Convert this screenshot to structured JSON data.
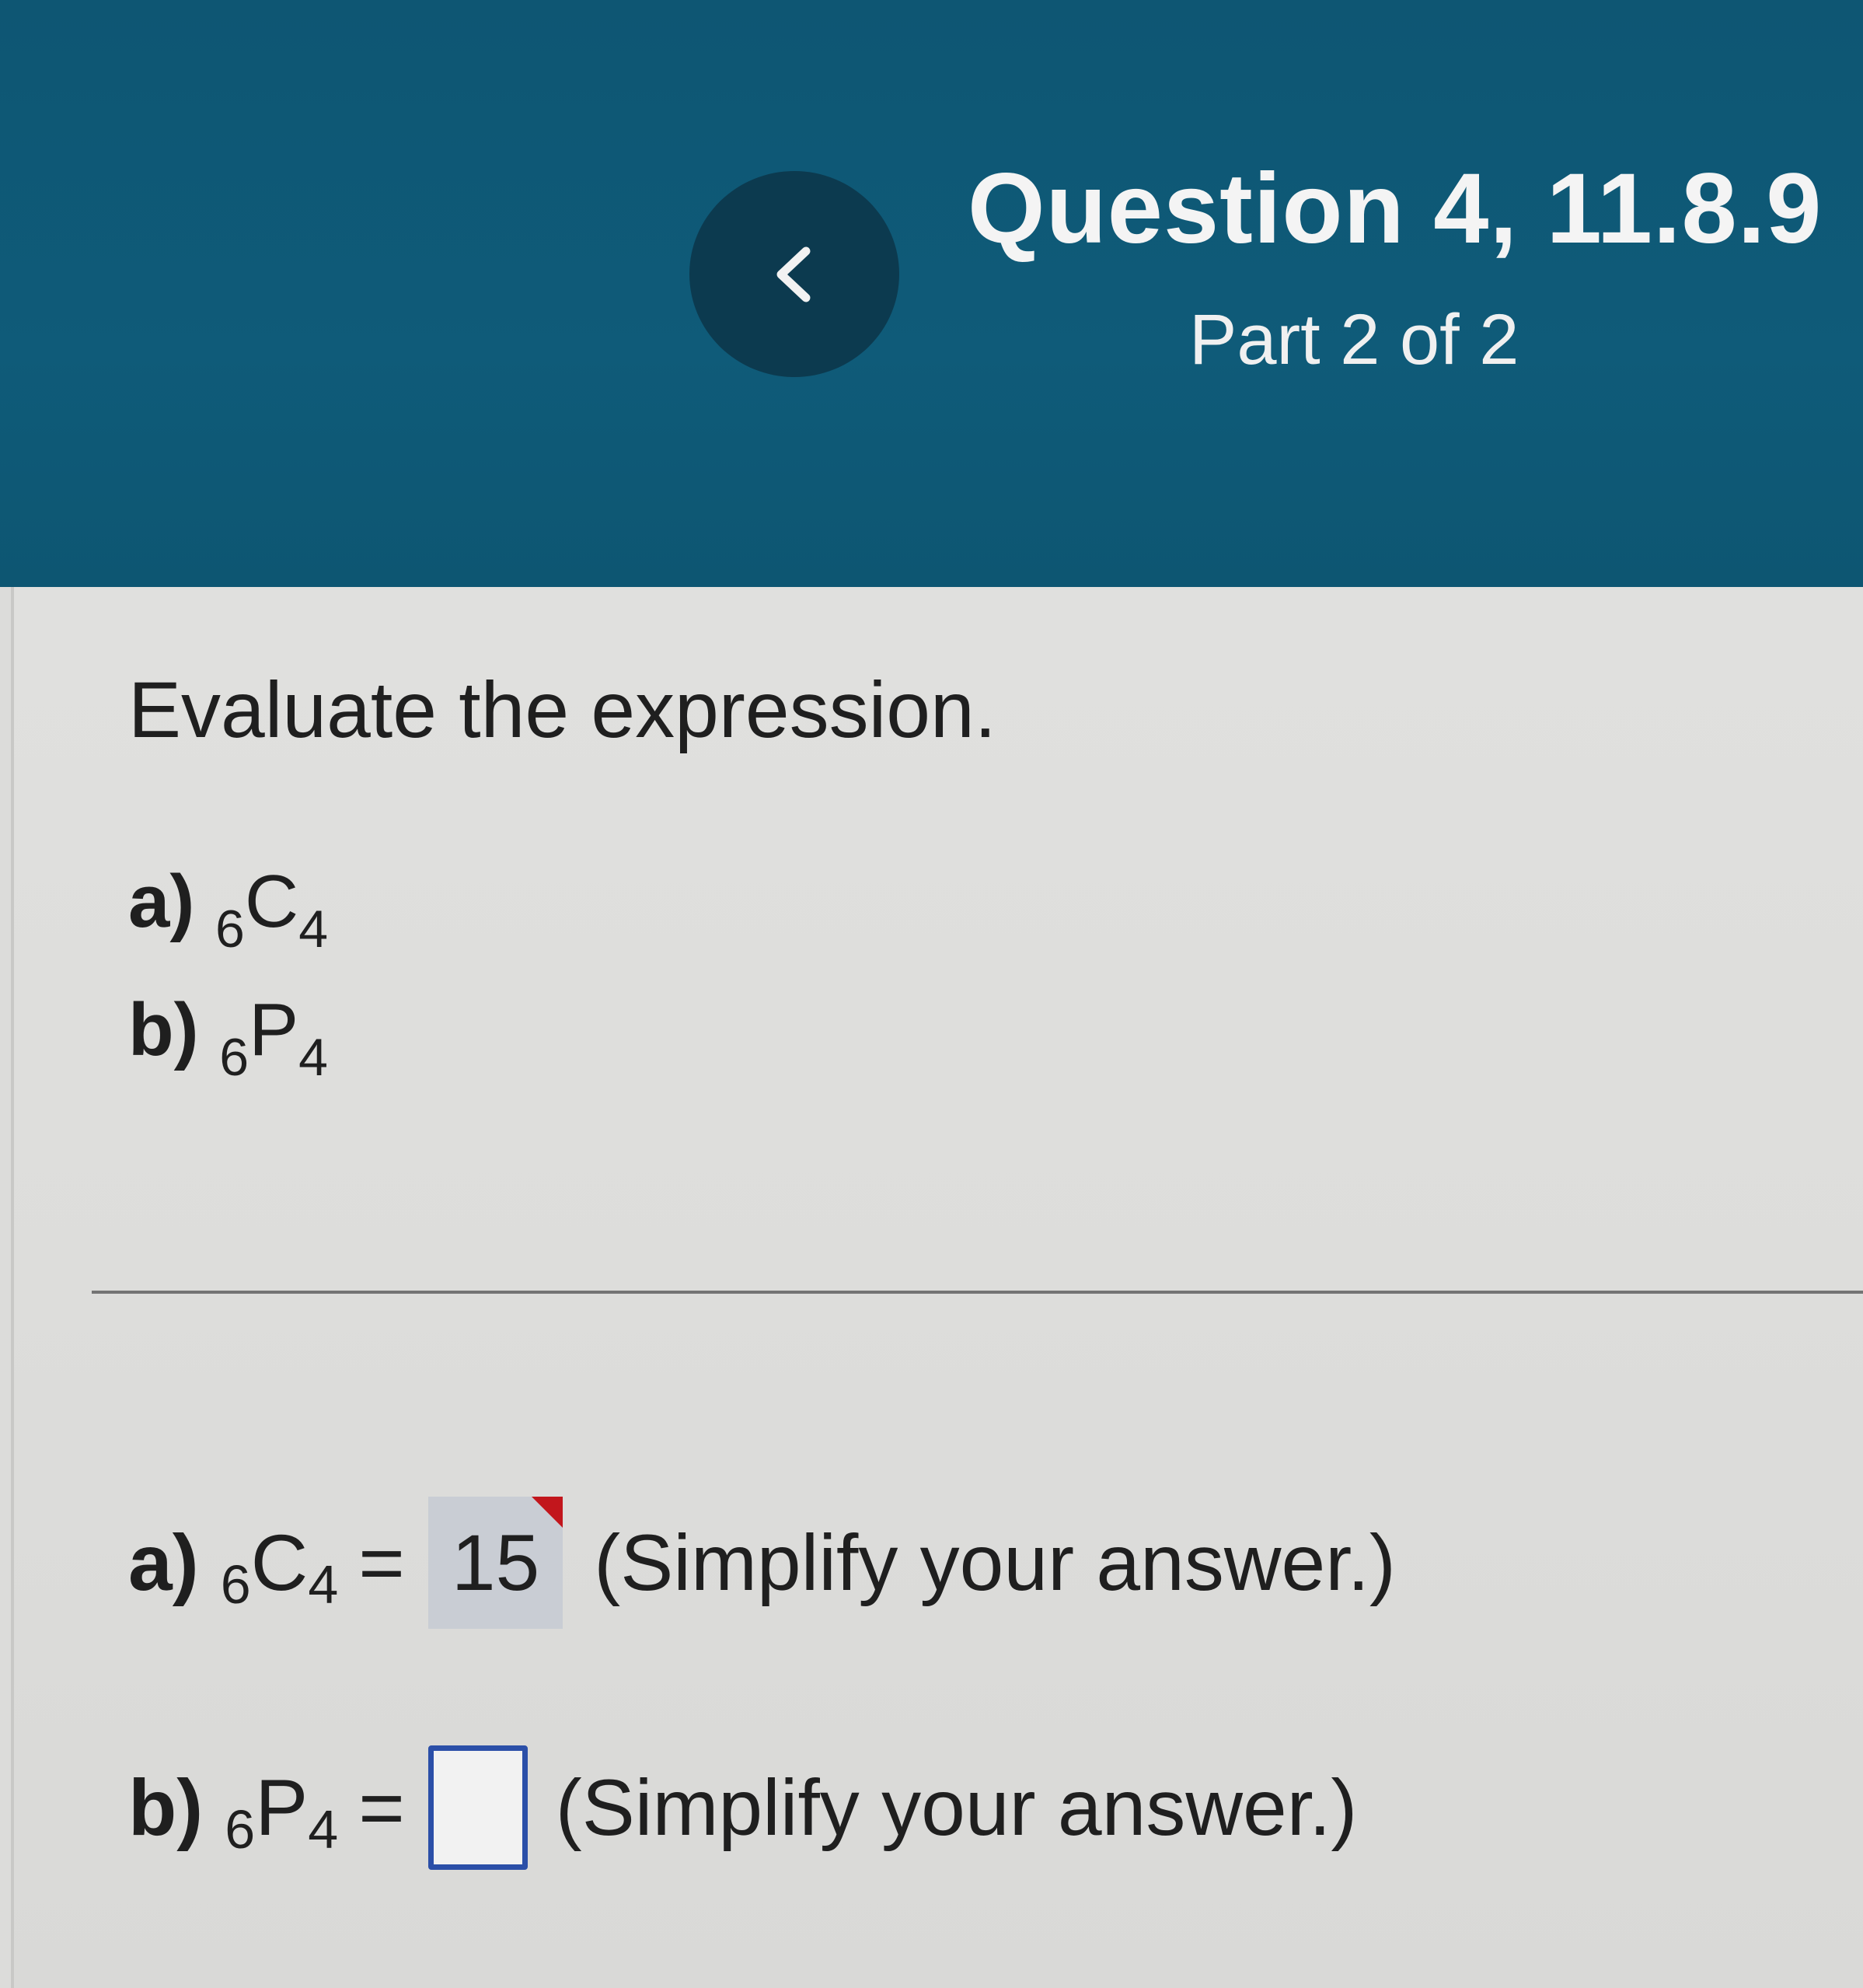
{
  "header": {
    "title": "Question 4, 11.8.9",
    "part": "Part 2 of 2",
    "back_icon": "chevron-left-icon"
  },
  "question": {
    "prompt": "Evaluate the expression.",
    "items": [
      {
        "label": "a)",
        "pre": "6",
        "letter": "C",
        "post": "4"
      },
      {
        "label": "b)",
        "pre": "6",
        "letter": "P",
        "post": "4"
      }
    ]
  },
  "answers": [
    {
      "label": "a)",
      "pre": "6",
      "letter": "C",
      "post": "4",
      "equals": "=",
      "value": "15",
      "hint": "(Simplify your answer.)",
      "status_color": "#c2161c"
    },
    {
      "label": "b)",
      "pre": "6",
      "letter": "P",
      "post": "4",
      "equals": "=",
      "value": "",
      "hint": "(Simplify your answer.)",
      "input_border_color": "#2b4fa8"
    }
  ]
}
